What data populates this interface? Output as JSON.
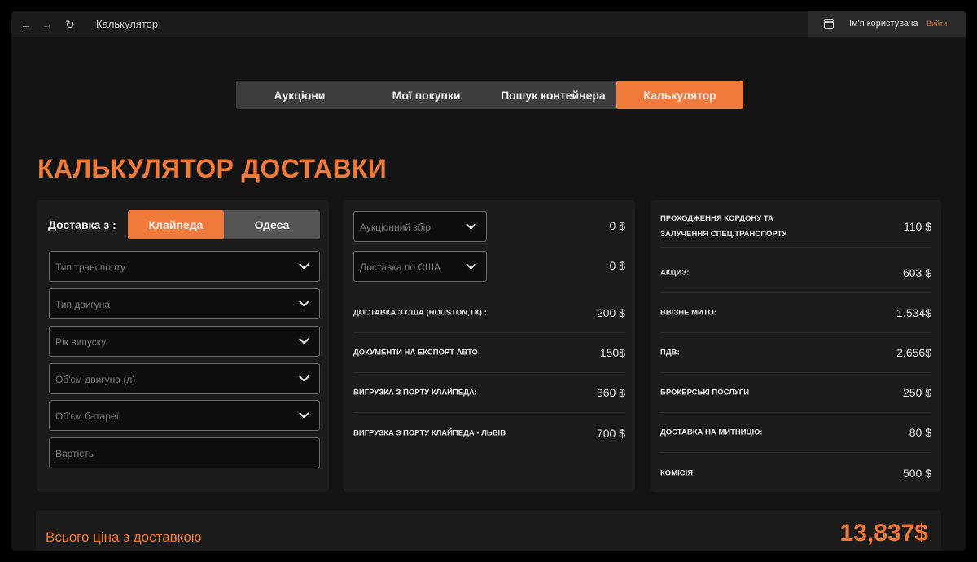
{
  "topbar": {
    "back_icon": "←",
    "forward_icon": "→",
    "reload_icon": "↻",
    "page_name": "Калькулятор",
    "user_name": "Ім'я користувача",
    "logout": "Вийти"
  },
  "tabs": [
    {
      "label": "Аукціони",
      "active": false
    },
    {
      "label": "Мої покупки",
      "active": false
    },
    {
      "label": "Пошук контейнера",
      "active": false
    },
    {
      "label": "Калькулятор",
      "active": true
    }
  ],
  "title": "КАЛЬКУЛЯТОР ДОСТАВКИ",
  "left_panel": {
    "from_label": "Доставка з :",
    "from_options": [
      {
        "label": "Клайпеда",
        "active": true
      },
      {
        "label": "Одеса",
        "active": false
      }
    ],
    "fields": [
      {
        "placeholder": "Тип транспорту",
        "dropdown": true
      },
      {
        "placeholder": "Тип двигуна",
        "dropdown": true
      },
      {
        "placeholder": "Рік випуску",
        "dropdown": true
      },
      {
        "placeholder": "Об'єм двигуна (л)",
        "dropdown": true
      },
      {
        "placeholder": "Об'єм батареї",
        "dropdown": true
      },
      {
        "placeholder": "Вартість",
        "dropdown": false
      }
    ]
  },
  "middle_panel": {
    "selects": [
      {
        "placeholder": "Аукціонний збір",
        "value": "0 $"
      },
      {
        "placeholder": "Доставка по США",
        "value": "0 $"
      }
    ],
    "rows": [
      {
        "label": "ДОСТАВКА З США (HOUSTON,TX) :",
        "value": "200 $"
      },
      {
        "label": "ДОКУМЕНТИ НА ЕКСПОРТ АВТО",
        "value": "150$"
      },
      {
        "label": "ВИГРУЗКА З ПОРТУ КЛАЙПЕДА:",
        "value": "360 $"
      },
      {
        "label": "ВИГРУЗКА З ПОРТУ КЛАЙПЕДА - ЛЬВІВ",
        "value": "700 $"
      }
    ]
  },
  "right_panel": {
    "rows": [
      {
        "label_line1": "ПРОХОДЖЕННЯ КОРДОНУ ТА",
        "label_line2": "ЗАЛУЧЕННЯ СПЕЦ.ТРАНСПОРТУ",
        "value": "110 $"
      },
      {
        "label": "АКЦИЗ:",
        "value": "603 $"
      },
      {
        "label": "ВВІЗНЕ МИТО:",
        "value": "1,534$"
      },
      {
        "label": "ПДВ:",
        "value": "2,656$"
      },
      {
        "label": "БРОКЕРСЬКІ ПОСЛУГИ",
        "value": "250 $"
      },
      {
        "label": "ДОСТАВКА НА МИТНИЦЮ:",
        "value": "80 $"
      },
      {
        "label": "КОМІСІЯ",
        "value": "500 $"
      }
    ]
  },
  "total": {
    "label": "Всього ціна з доставкою",
    "value": "13,837$"
  },
  "colors": {
    "accent": "#f07a3a",
    "background": "#141414",
    "panel": "#1c1c1c"
  }
}
